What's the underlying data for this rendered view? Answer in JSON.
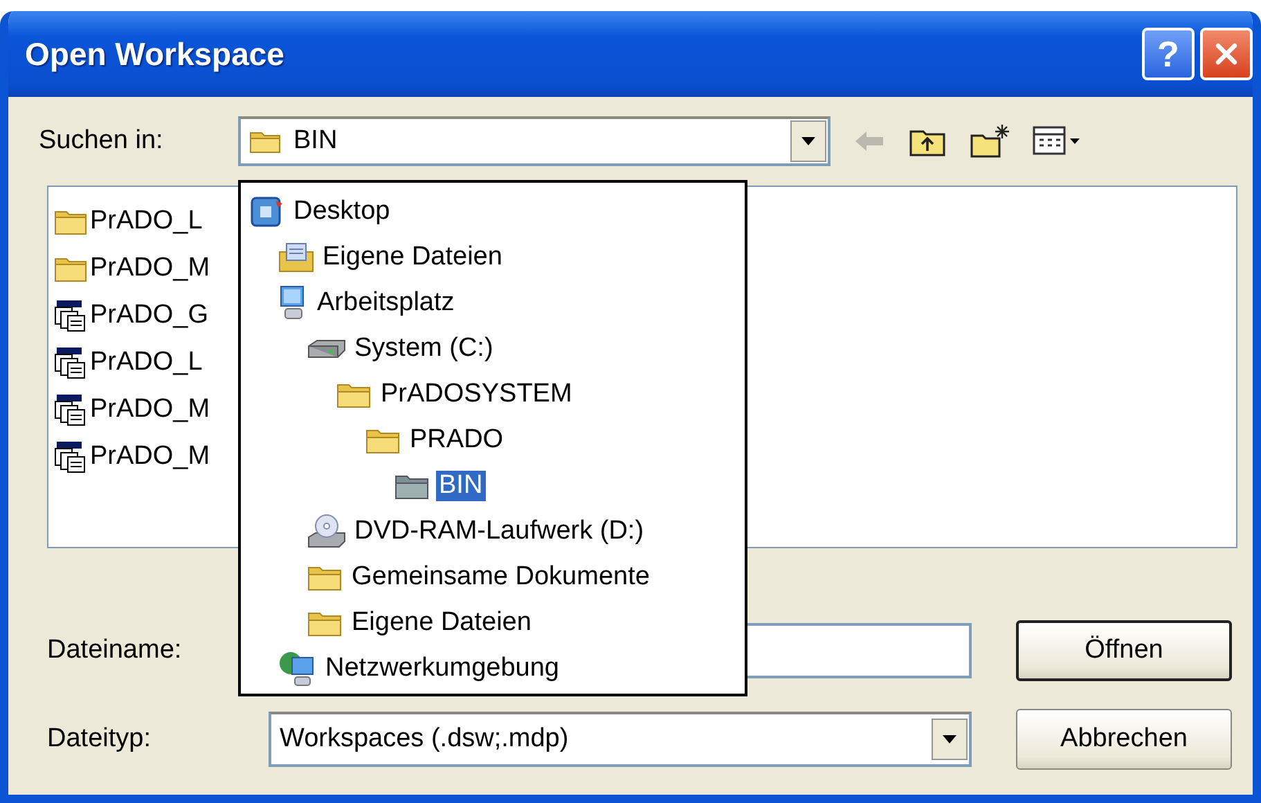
{
  "window": {
    "title": "Open Workspace",
    "help": "?"
  },
  "look_in": {
    "label": "Suchen in:",
    "value": "BIN"
  },
  "files": [
    {
      "name": "PrADO_L",
      "kind": "folder"
    },
    {
      "name": "PrADO_M",
      "kind": "folder"
    },
    {
      "name": "PrADO_G",
      "kind": "workspace"
    },
    {
      "name": "PrADO_L",
      "kind": "workspace"
    },
    {
      "name": "PrADO_M",
      "kind": "workspace"
    },
    {
      "name": "PrADO_M",
      "kind": "workspace"
    }
  ],
  "dropdown": {
    "items": [
      {
        "label": "Desktop",
        "kind": "desktop",
        "selected": false,
        "children": [
          {
            "label": "Eigene Dateien",
            "kind": "documents",
            "selected": false
          },
          {
            "label": "Arbeitsplatz",
            "kind": "computer",
            "selected": false,
            "children": [
              {
                "label": "System (C:)",
                "kind": "drive",
                "selected": false,
                "children": [
                  {
                    "label": "PrADOSYSTEM",
                    "kind": "folder",
                    "selected": false,
                    "children": [
                      {
                        "label": "PRADO",
                        "kind": "folder",
                        "selected": false,
                        "children": [
                          {
                            "label": "BIN",
                            "kind": "folder",
                            "selected": true
                          }
                        ]
                      }
                    ]
                  }
                ]
              },
              {
                "label": "DVD-RAM-Laufwerk (D:)",
                "kind": "dvd",
                "selected": false
              },
              {
                "label": "Gemeinsame Dokumente",
                "kind": "folder",
                "selected": false
              },
              {
                "label": "Eigene Dateien",
                "kind": "folder",
                "selected": false
              }
            ]
          },
          {
            "label": "Netzwerkumgebung",
            "kind": "network",
            "selected": false
          }
        ]
      }
    ]
  },
  "filename": {
    "label": "Dateiname:"
  },
  "filetype": {
    "label": "Dateityp:",
    "value": "Workspaces (.dsw;.mdp)"
  },
  "buttons": [
    {
      "label": "Öffnen",
      "default": true
    },
    {
      "label": "Abbrechen",
      "default": false
    }
  ]
}
